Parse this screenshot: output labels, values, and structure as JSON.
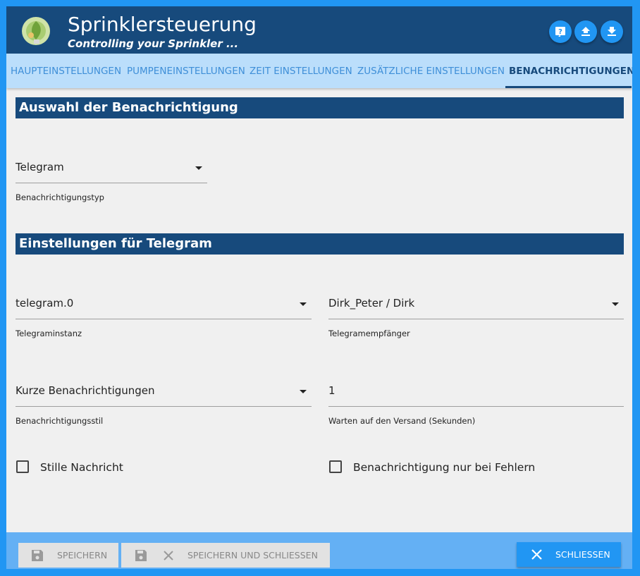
{
  "header": {
    "title": "Sprinklersteuerung",
    "subtitle": "Controlling your Sprinkler ...",
    "buttons": [
      {
        "icon": "help-icon"
      },
      {
        "icon": "upload-icon"
      },
      {
        "icon": "download-icon"
      }
    ]
  },
  "tabs": [
    {
      "label": "HAUPTEINSTELLUNGEN",
      "active": false
    },
    {
      "label": "PUMPENEINSTELLUNGEN",
      "active": false
    },
    {
      "label": "ZEIT EINSTELLUNGEN",
      "active": false
    },
    {
      "label": "ZUSÄTZLICHE EINSTELLUNGEN",
      "active": false
    },
    {
      "label": "BENACHRICHTIGUNGEN",
      "active": true
    }
  ],
  "sections": {
    "selection_title": "Auswahl der Benachrichtigung",
    "settings_title": "Einstellungen für Telegram"
  },
  "fields": {
    "notification_type": {
      "value": "Telegram",
      "label": "Benachrichtigungstyp"
    },
    "telegram_instance": {
      "value": "telegram.0",
      "label": "Telegraminstanz"
    },
    "telegram_recipient": {
      "value": "Dirk_Peter / Dirk",
      "label": "Telegramempfänger"
    },
    "notification_style": {
      "value": "Kurze Benachrichtigungen",
      "label": "Benachrichtigungsstil"
    },
    "send_delay": {
      "value": "1",
      "label": "Warten auf den Versand (Sekunden)"
    }
  },
  "checkboxes": {
    "silent": {
      "label": "Stille Nachricht",
      "checked": false
    },
    "errors_only": {
      "label": "Benachrichtigung nur bei Fehlern",
      "checked": false
    }
  },
  "footer": {
    "save_label": "SPEICHERN",
    "save_close_label": "SPEICHERN UND SCHLIESSEN",
    "close_label": "SCHLIESSEN"
  },
  "colors": {
    "frame": "#2196f3",
    "header": "#174a7c",
    "tabs_bg": "#bbdefb",
    "accent": "#2196f3",
    "footer": "#64b0f4"
  }
}
